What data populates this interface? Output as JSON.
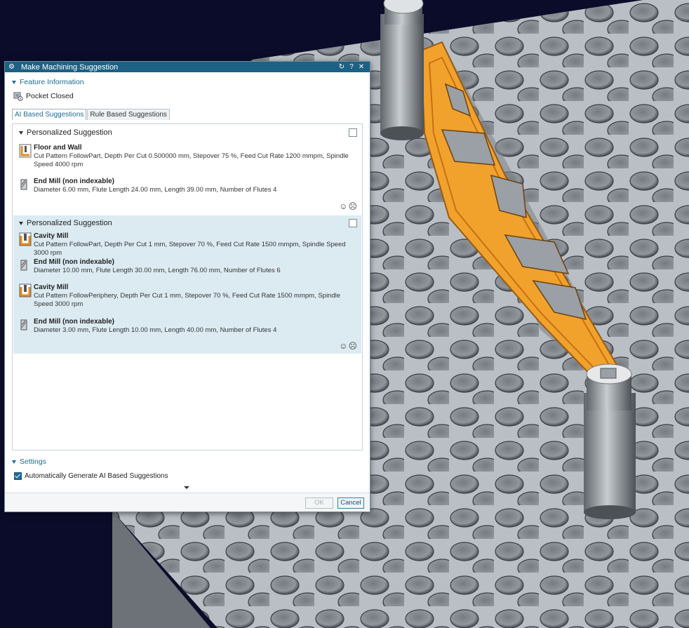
{
  "dialog": {
    "title": "Make Machining Suggestion",
    "feature_section": {
      "label": "Feature Information",
      "feature": "Pocket Closed"
    },
    "tabs": [
      {
        "label": "AI Based Suggestions",
        "active": true
      },
      {
        "label": "Rule Based Suggestions",
        "active": false
      }
    ],
    "suggestions": [
      {
        "label": "Personalized Suggestion",
        "items": [
          {
            "kind": "operation",
            "icon": "floor-wall-icon",
            "name": "Floor and Wall",
            "desc": "Cut Pattern FollowPart, Depth Per Cut 0.500000 mm, Stepover 75 %, Feed Cut Rate 1200 mmpm, Spindle Speed 4000 rpm"
          },
          {
            "kind": "tool",
            "icon": "end-mill-icon",
            "name": "End Mill (non indexable)",
            "desc": "Diameter 6.00 mm, Flute Length 24.00 mm, Length 39.00 mm, Number of Flutes 4"
          }
        ]
      },
      {
        "label": "Personalized Suggestion",
        "items": [
          {
            "kind": "operation",
            "icon": "cavity-mill-icon",
            "name": "Cavity Mill",
            "desc": "Cut Pattern FollowPart, Depth Per Cut 1 mm, Stepover 70 %, Feed Cut Rate 1500 mmpm, Spindle Speed 3000 rpm"
          },
          {
            "kind": "tool",
            "icon": "end-mill-icon",
            "name": "End Mill (non indexable)",
            "desc": "Diameter 10.00 mm, Flute Length 30.00 mm, Length 76.00 mm, Number of Flutes 6"
          },
          {
            "kind": "operation",
            "icon": "cavity-mill-icon",
            "name": "Cavity Mill",
            "desc": "Cut Pattern FollowPeriphery, Depth Per Cut 1 mm, Stepover 70 %, Feed Cut Rate 1500 mmpm, Spindle Speed 3000 rpm"
          },
          {
            "kind": "tool",
            "icon": "end-mill-icon",
            "name": "End Mill (non indexable)",
            "desc": "Diameter 3.00 mm, Flute Length 10.00 mm, Length 40.00 mm, Number of Flutes 4"
          }
        ]
      }
    ],
    "settings": {
      "label": "Settings",
      "auto_generate": "Automatically Generate AI Based Suggestions"
    },
    "buttons": {
      "ok": "OK",
      "cancel": "Cancel"
    }
  },
  "colors": {
    "title_bar": "#1d6184",
    "accent": "#1d6c94",
    "highlight_row": "#dcebf2",
    "part_orange": "#f0a22d",
    "plate_gray": "#b9bfc4"
  }
}
